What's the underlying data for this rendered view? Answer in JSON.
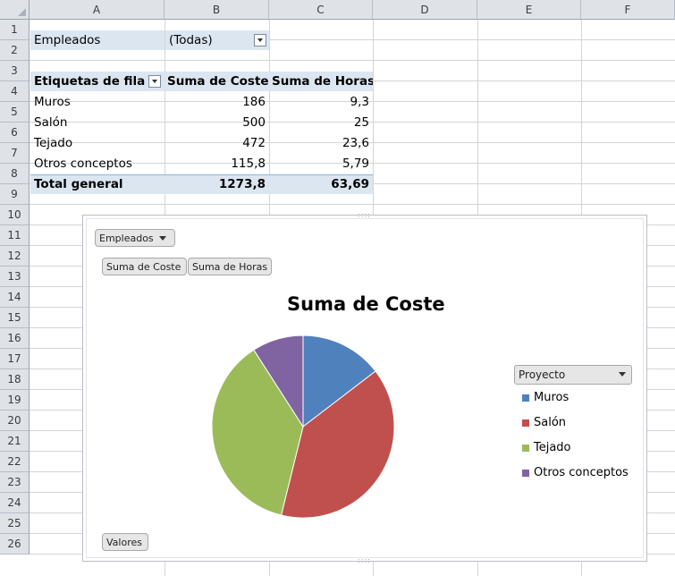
{
  "columns": [
    "A",
    "B",
    "C",
    "D",
    "E",
    "F"
  ],
  "rows": [
    "1",
    "2",
    "3",
    "4",
    "5",
    "6",
    "7",
    "8",
    "9",
    "10",
    "11",
    "12",
    "13",
    "14",
    "15",
    "16",
    "17",
    "18",
    "19",
    "20",
    "21",
    "22",
    "23",
    "24",
    "25",
    "26"
  ],
  "filter": {
    "label": "Empleados",
    "value": "(Todas)"
  },
  "pivot": {
    "headers": [
      "Etiquetas de fila",
      "Suma de Coste",
      "Suma de Horas"
    ],
    "rows": [
      {
        "label": "Muros",
        "coste": "186",
        "horas": "9,3"
      },
      {
        "label": "Salón",
        "coste": "500",
        "horas": "25"
      },
      {
        "label": "Tejado",
        "coste": "472",
        "horas": "23,6"
      },
      {
        "label": "Otros conceptos",
        "coste": "115,8",
        "horas": "5,79"
      }
    ],
    "total": {
      "label": "Total general",
      "coste": "1273,8",
      "horas": "63,69"
    }
  },
  "chart": {
    "filter_button": "Empleados",
    "value_buttons": [
      "Suma de Coste",
      "Suma de Horas"
    ],
    "legend_header": "Proyecto",
    "axis_button": "Valores"
  },
  "chart_data": {
    "type": "pie",
    "title": "Suma de Coste",
    "categories": [
      "Muros",
      "Salón",
      "Tejado",
      "Otros conceptos"
    ],
    "values": [
      186,
      500,
      472,
      115.8
    ],
    "colors": [
      "#4f81bd",
      "#c0504d",
      "#9bbb59",
      "#8064a2"
    ],
    "legend": "right"
  }
}
